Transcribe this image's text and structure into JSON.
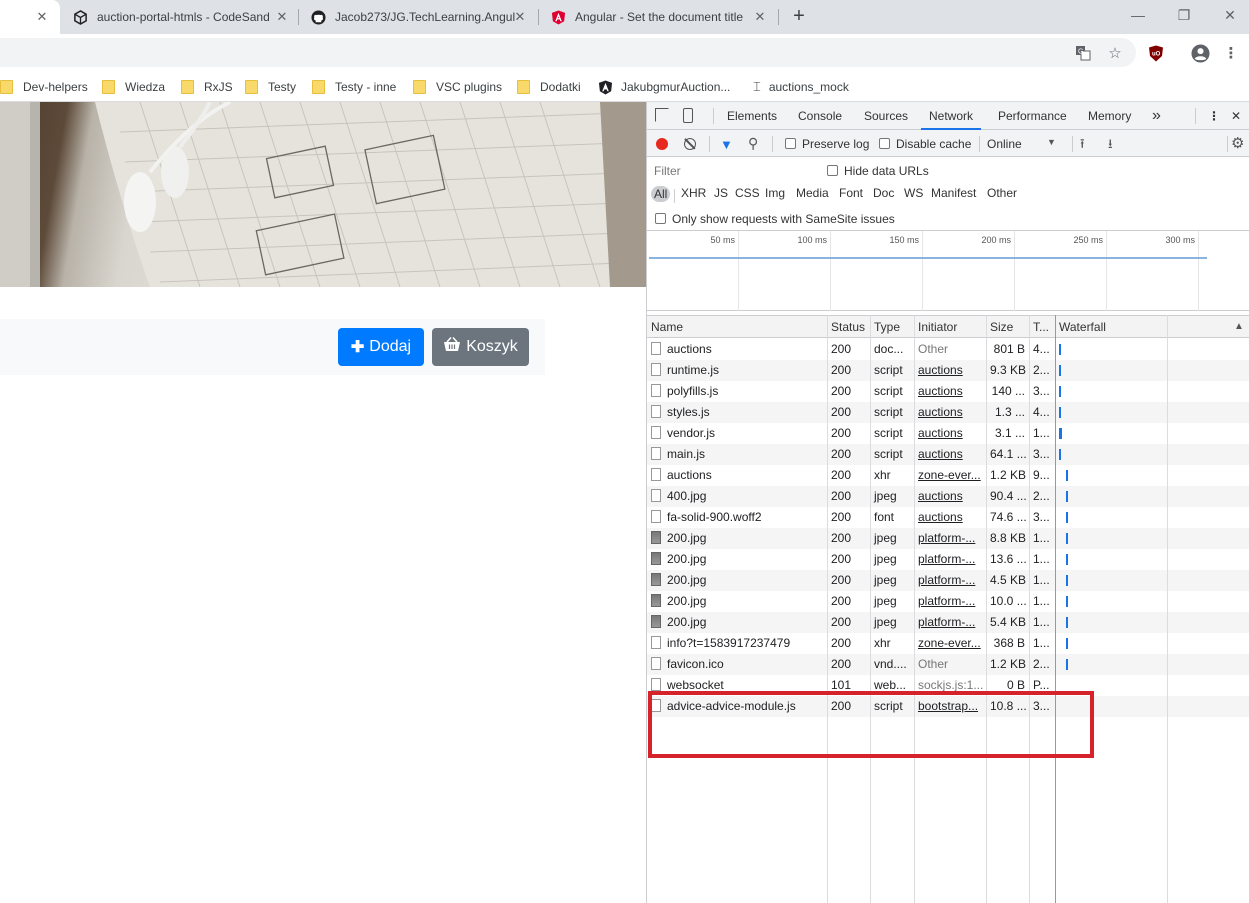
{
  "tabs": [
    {
      "title": "",
      "active": true
    },
    {
      "title": "auction-portal-htmls - CodeSand",
      "icon": "codesandbox-icon"
    },
    {
      "title": "Jacob273/JG.TechLearning.Angul",
      "icon": "github-icon"
    },
    {
      "title": "Angular - Set the document title",
      "icon": "angular-icon"
    }
  ],
  "new_tab": "+",
  "window": {
    "minimize": "—",
    "restore": "❐",
    "close": "✕"
  },
  "bookmarks": [
    {
      "label": "Dev-helpers",
      "type": "folder"
    },
    {
      "label": "Wiedza",
      "type": "folder"
    },
    {
      "label": "RxJS",
      "type": "folder"
    },
    {
      "label": "Testy",
      "type": "folder"
    },
    {
      "label": "Testy - inne",
      "type": "folder"
    },
    {
      "label": "VSC plugins",
      "type": "folder"
    },
    {
      "label": "Dodatki",
      "type": "folder"
    },
    {
      "label": "JakubgmurAuction...",
      "type": "angular-icon"
    },
    {
      "label": "auctions_mock",
      "type": "mock-icon"
    }
  ],
  "page": {
    "add_button": "Dodaj",
    "cart_button": "Koszyk"
  },
  "devtools": {
    "tabs": [
      "Elements",
      "Console",
      "Sources",
      "Network",
      "Performance",
      "Memory"
    ],
    "active_tab": "Network",
    "more": "»",
    "preserve_log": "Preserve log",
    "disable_cache": "Disable cache",
    "throttle": "Online",
    "filter_placeholder": "Filter",
    "hide_data_urls": "Hide data URLs",
    "types": [
      "All",
      "XHR",
      "JS",
      "CSS",
      "Img",
      "Media",
      "Font",
      "Doc",
      "WS",
      "Manifest",
      "Other"
    ],
    "samesite": "Only show requests with SameSite issues",
    "timeline_labels": [
      "50 ms",
      "100 ms",
      "150 ms",
      "200 ms",
      "250 ms",
      "300 ms"
    ],
    "columns": [
      "Name",
      "Status",
      "Type",
      "Initiator",
      "Size",
      "T...",
      "Waterfall"
    ],
    "rows": [
      {
        "name": "auctions",
        "status": "200",
        "type": "doc...",
        "initiator": "Other",
        "size": "801 B",
        "time": "4...",
        "icon": "doc",
        "link": false
      },
      {
        "name": "runtime.js",
        "status": "200",
        "type": "script",
        "initiator": "auctions",
        "size": "9.3 KB",
        "time": "2...",
        "icon": "doc",
        "link": true
      },
      {
        "name": "polyfills.js",
        "status": "200",
        "type": "script",
        "initiator": "auctions",
        "size": "140 ...",
        "time": "3...",
        "icon": "doc",
        "link": true
      },
      {
        "name": "styles.js",
        "status": "200",
        "type": "script",
        "initiator": "auctions",
        "size": "1.3 ...",
        "time": "4...",
        "icon": "doc",
        "link": true
      },
      {
        "name": "vendor.js",
        "status": "200",
        "type": "script",
        "initiator": "auctions",
        "size": "3.1 ...",
        "time": "1...",
        "icon": "doc",
        "link": true
      },
      {
        "name": "main.js",
        "status": "200",
        "type": "script",
        "initiator": "auctions",
        "size": "64.1 ...",
        "time": "3...",
        "icon": "doc",
        "link": true
      },
      {
        "name": "auctions",
        "status": "200",
        "type": "xhr",
        "initiator": "zone-ever...",
        "size": "1.2 KB",
        "time": "9...",
        "icon": "doc",
        "link": true
      },
      {
        "name": "400.jpg",
        "status": "200",
        "type": "jpeg",
        "initiator": "auctions",
        "size": "90.4 ...",
        "time": "2...",
        "icon": "doc",
        "link": true
      },
      {
        "name": "fa-solid-900.woff2",
        "status": "200",
        "type": "font",
        "initiator": "auctions",
        "size": "74.6 ...",
        "time": "3...",
        "icon": "doc",
        "link": true
      },
      {
        "name": "200.jpg",
        "status": "200",
        "type": "jpeg",
        "initiator": "platform-...",
        "size": "8.8 KB",
        "time": "1...",
        "icon": "img",
        "link": true
      },
      {
        "name": "200.jpg",
        "status": "200",
        "type": "jpeg",
        "initiator": "platform-...",
        "size": "13.6 ...",
        "time": "1...",
        "icon": "img",
        "link": true
      },
      {
        "name": "200.jpg",
        "status": "200",
        "type": "jpeg",
        "initiator": "platform-...",
        "size": "4.5 KB",
        "time": "1...",
        "icon": "img",
        "link": true
      },
      {
        "name": "200.jpg",
        "status": "200",
        "type": "jpeg",
        "initiator": "platform-...",
        "size": "10.0 ...",
        "time": "1...",
        "icon": "img",
        "link": true
      },
      {
        "name": "200.jpg",
        "status": "200",
        "type": "jpeg",
        "initiator": "platform-...",
        "size": "5.4 KB",
        "time": "1...",
        "icon": "img",
        "link": true
      },
      {
        "name": "info?t=1583917237479",
        "status": "200",
        "type": "xhr",
        "initiator": "zone-ever...",
        "size": "368 B",
        "time": "1...",
        "icon": "doc",
        "link": true
      },
      {
        "name": "favicon.ico",
        "status": "200",
        "type": "vnd....",
        "initiator": "Other",
        "size": "1.2 KB",
        "time": "2...",
        "icon": "doc",
        "link": false
      },
      {
        "name": "websocket",
        "status": "101",
        "type": "web...",
        "initiator": "sockjs.js:1...",
        "size": "0 B",
        "time": "P...",
        "icon": "doc",
        "link": false
      },
      {
        "name": "advice-advice-module.js",
        "status": "200",
        "type": "script",
        "initiator": "bootstrap...",
        "size": "10.8 ...",
        "time": "3...",
        "icon": "doc",
        "link": true
      }
    ]
  },
  "colors": {
    "primary": "#007bff",
    "secondary": "#6c757d",
    "highlight": "#d6232b",
    "record": "#e8271f"
  }
}
